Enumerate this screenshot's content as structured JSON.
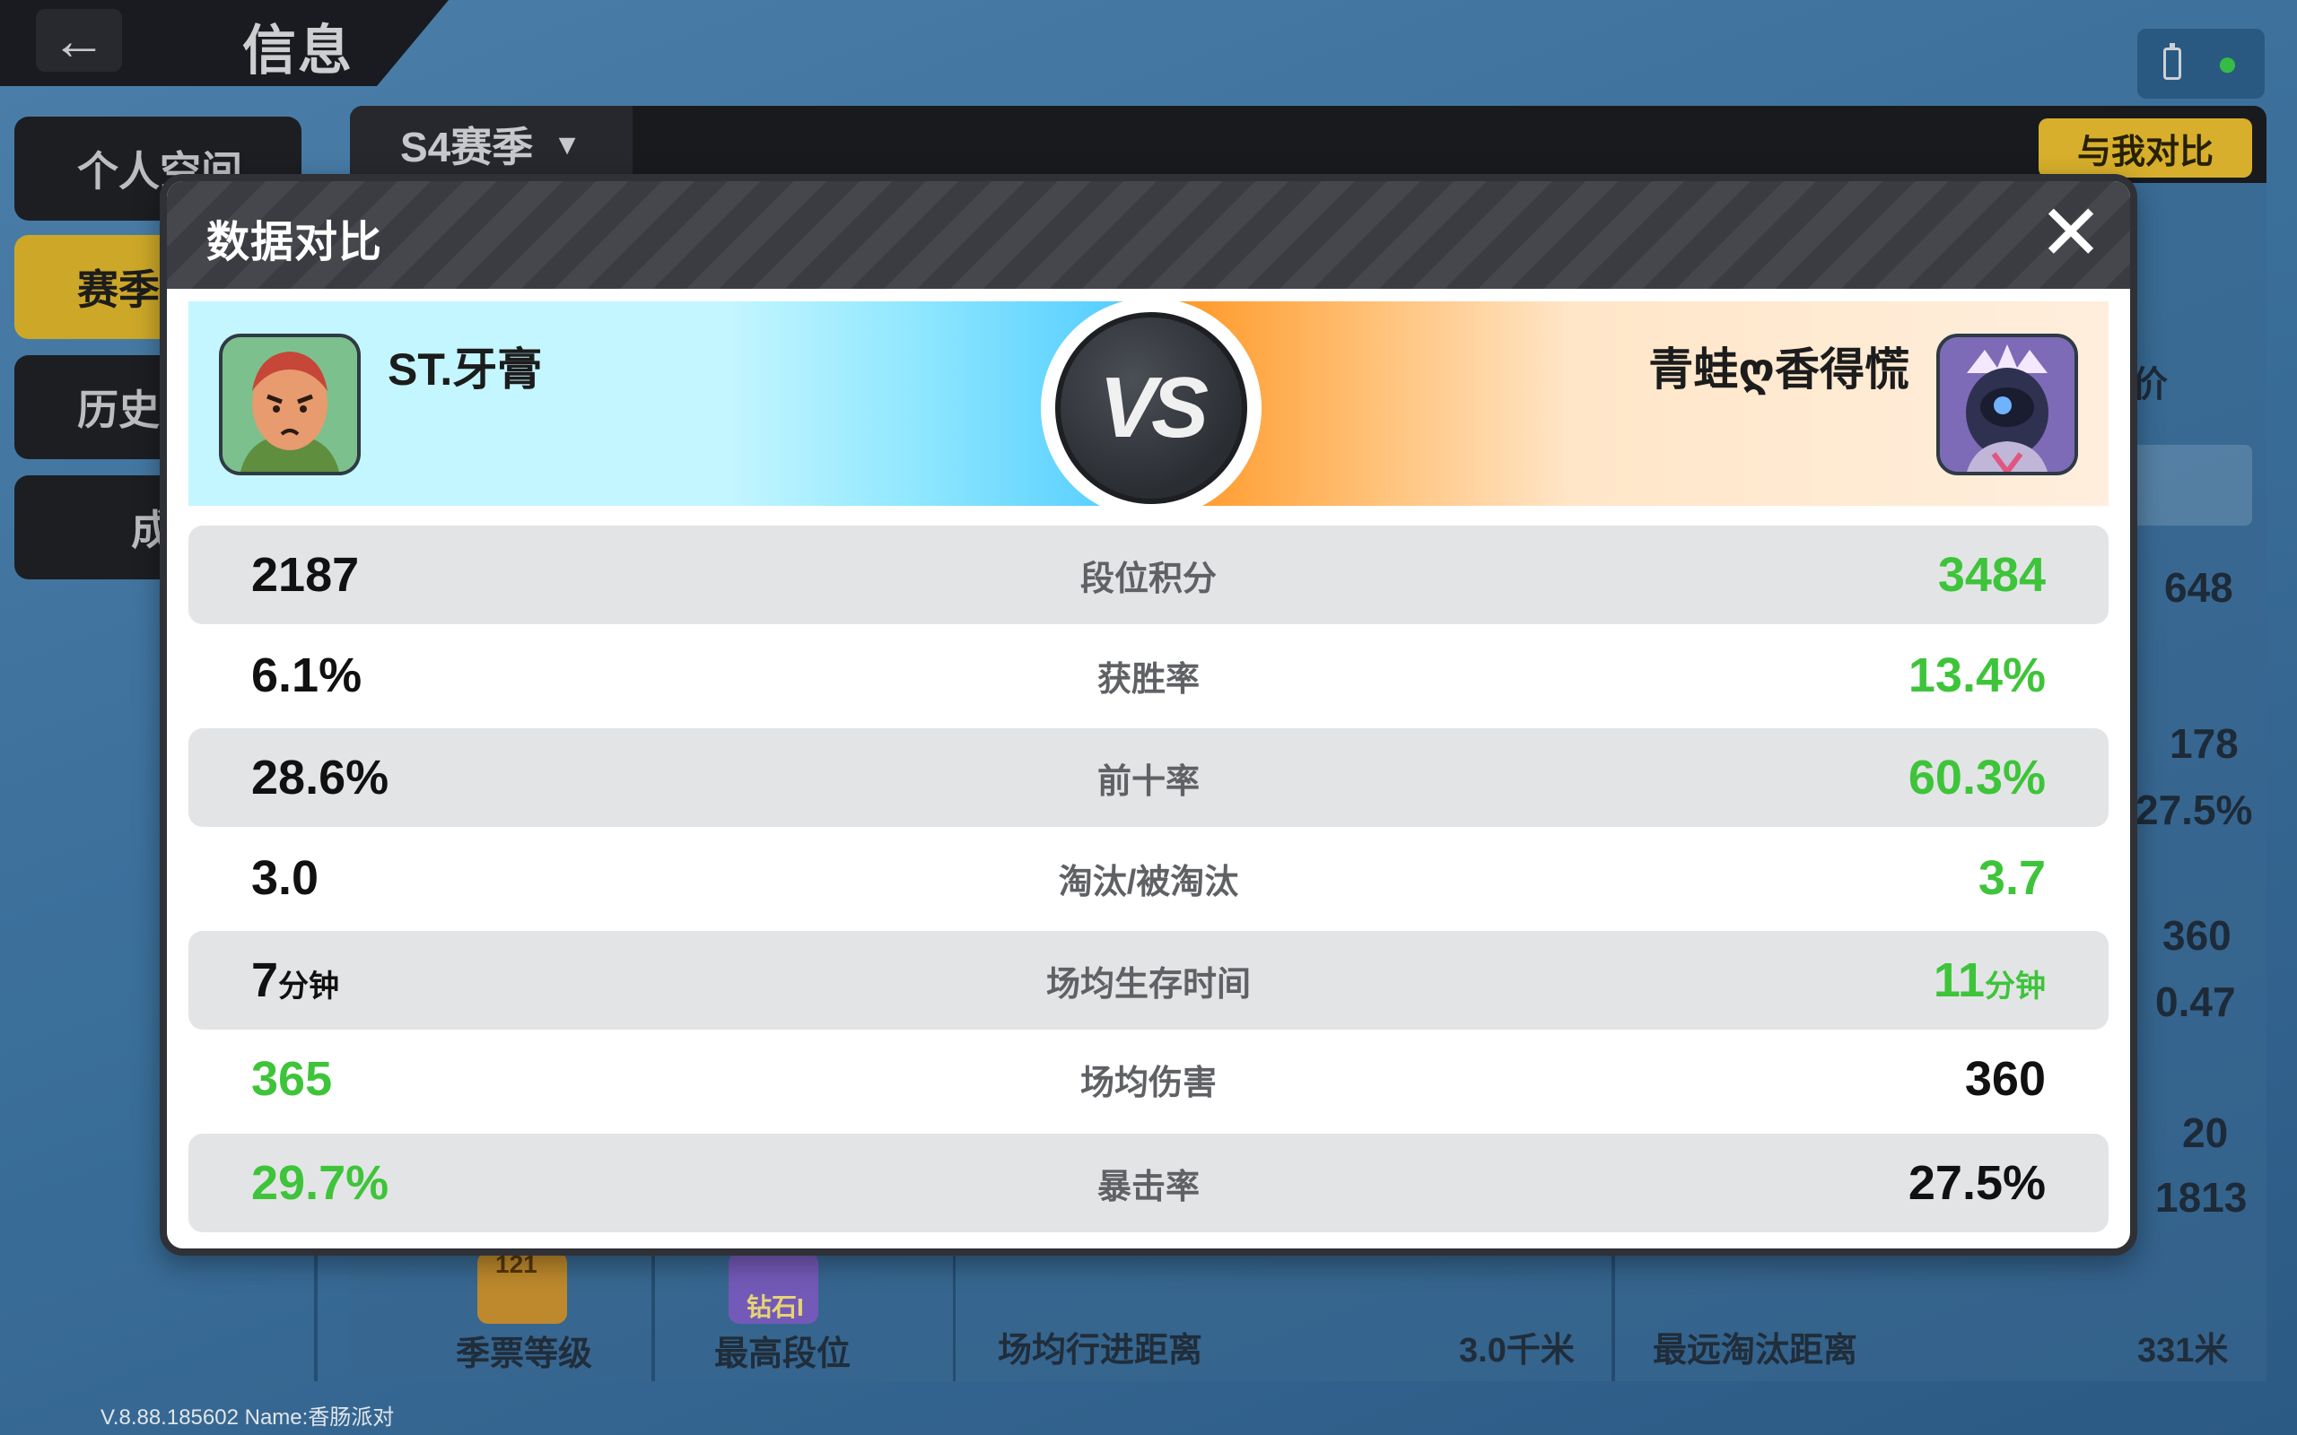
{
  "header": {
    "back_icon": "arrow-left-icon",
    "title": "信息"
  },
  "status": {
    "battery_icon": "battery-icon",
    "wifi_icon": "wifi-icon"
  },
  "sidebar": {
    "items": [
      {
        "label": "个人空间",
        "active": false
      },
      {
        "label": "赛季",
        "active": true
      },
      {
        "label": "历史",
        "active": false
      },
      {
        "label": "成",
        "active": false
      }
    ]
  },
  "season": {
    "selected": "S4赛季",
    "compare_button": "与我对比"
  },
  "background_fragments": {
    "right_label": "价",
    "values": [
      "648",
      "178",
      "27.5%",
      "360",
      "0.47",
      "20",
      "1813"
    ],
    "bottom": {
      "season_pass_label": "季票等级",
      "season_pass_badge": "121",
      "highest_rank_label": "最高段位",
      "highest_rank_badge": "钻石I",
      "avg_travel_label": "场均行进距离",
      "avg_travel_value": "3.0千米",
      "longest_kill_label": "最远淘汰距离",
      "longest_kill_value": "331米"
    }
  },
  "version_text": "V.8.88.185602 Name:香肠派对",
  "modal": {
    "title": "数据对比",
    "close_icon": "close-icon",
    "left_player": {
      "name": "ST.牙膏",
      "avatar_icon": "bald-bearded-character-avatar"
    },
    "right_player": {
      "name": "青蛙ღ香得慌",
      "avatar_icon": "robot-helmet-character-avatar"
    },
    "vs_text": "VS",
    "highlight_color": "#3ec43a",
    "stats": [
      {
        "label": "段位积分",
        "left": "2187",
        "left_unit": "",
        "right": "3484",
        "right_unit": ""
      },
      {
        "label": "获胜率",
        "left": "6.1%",
        "left_unit": "",
        "right": "13.4%",
        "right_unit": ""
      },
      {
        "label": "前十率",
        "left": "28.6%",
        "left_unit": "",
        "right": "60.3%",
        "right_unit": ""
      },
      {
        "label": "淘汰/被淘汰",
        "left": "3.0",
        "left_unit": "",
        "right": "3.7",
        "right_unit": ""
      },
      {
        "label": "场均生存时间",
        "left": "7",
        "left_unit": "分钟",
        "right": "11",
        "right_unit": "分钟"
      },
      {
        "label": "场均伤害",
        "left": "365",
        "left_unit": "",
        "right": "360",
        "right_unit": ""
      },
      {
        "label": "暴击率",
        "left": "29.7%",
        "left_unit": "",
        "right": "27.5%",
        "right_unit": ""
      }
    ]
  }
}
